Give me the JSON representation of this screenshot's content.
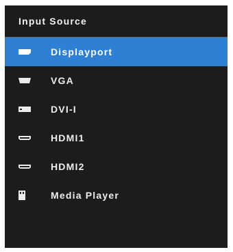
{
  "osd": {
    "title": "Input Source",
    "items": [
      {
        "label": "Displayport",
        "icon": "displayport-icon",
        "selected": true
      },
      {
        "label": "VGA",
        "icon": "vga-icon",
        "selected": false
      },
      {
        "label": "DVI-I",
        "icon": "dvi-icon",
        "selected": false
      },
      {
        "label": "HDMI1",
        "icon": "hdmi-icon",
        "selected": false
      },
      {
        "label": "HDMI2",
        "icon": "hdmi-icon",
        "selected": false
      },
      {
        "label": "Media Player",
        "icon": "usb-icon",
        "selected": false
      }
    ]
  },
  "colors": {
    "background": "#1c1c1c",
    "selected": "#2f7fd4",
    "text": "#f2f2f2"
  }
}
